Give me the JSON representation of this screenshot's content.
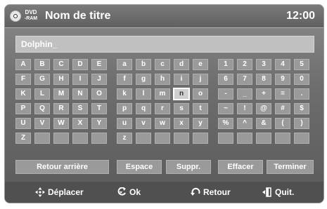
{
  "header": {
    "disc_type_top": "DVD",
    "disc_type_bottom": "-RAM",
    "title": "Nom de titre",
    "clock": "12:00"
  },
  "name_field": {
    "value": "Dolphin_"
  },
  "keyboard": {
    "rows": [
      [
        "A",
        "B",
        "C",
        "D",
        "E",
        "a",
        "b",
        "c",
        "d",
        "e",
        "1",
        "2",
        "3",
        "4",
        "5"
      ],
      [
        "F",
        "G",
        "H",
        "I",
        "J",
        "f",
        "g",
        "h",
        "i",
        "j",
        "6",
        "7",
        "8",
        "9",
        "0"
      ],
      [
        "K",
        "L",
        "M",
        "N",
        "O",
        "k",
        "l",
        "m",
        "n",
        "o",
        "-",
        "_",
        "+",
        "=",
        "."
      ],
      [
        "P",
        "Q",
        "R",
        "S",
        "T",
        "p",
        "q",
        "r",
        "s",
        "t",
        "~",
        "!",
        "@",
        "#",
        "$"
      ],
      [
        "U",
        "V",
        "W",
        "X",
        "Y",
        "u",
        "v",
        "w",
        "x",
        "y",
        "%",
        "^",
        "&",
        "(",
        ")"
      ],
      [
        "Z",
        "",
        "",
        "",
        "",
        "z",
        "",
        "",
        "",
        "",
        "",
        "",
        "",
        "",
        ""
      ]
    ],
    "selected_key": "n"
  },
  "function_keys": {
    "backspace": "Retour arrière",
    "space": "Espace",
    "delete": "Suppr.",
    "clear": "Effacer",
    "finish": "Terminer"
  },
  "footer": {
    "move": "Déplacer",
    "ok": "Ok",
    "back": "Retour",
    "quit": "Quit."
  },
  "icons": {
    "move": "move-arrows-icon",
    "ok": "enter-icon",
    "back": "return-arrow-icon",
    "quit": "exit-door-icon",
    "disc": "disc-icon"
  }
}
